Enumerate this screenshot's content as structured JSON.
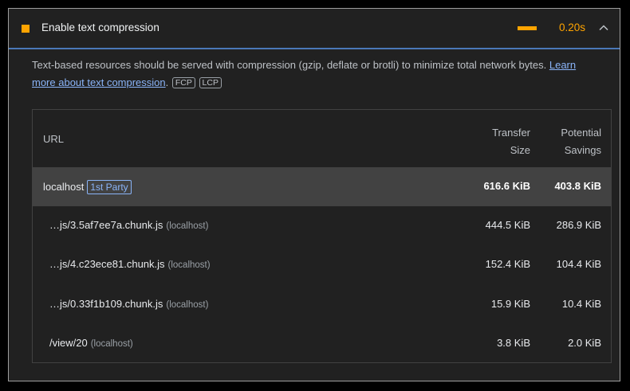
{
  "audit": {
    "title": "Enable text compression",
    "savings": "0.20s",
    "status_color": "#ffa400",
    "icon": "chevron-up-icon"
  },
  "description": {
    "text": "Text-based resources should be served with compression (gzip, deflate or brotli) to minimize total network bytes. ",
    "link_text": "Learn more about text compression",
    "after_link": ".",
    "badges": [
      "FCP",
      "LCP"
    ]
  },
  "table": {
    "headers": {
      "url": "URL",
      "transfer_size_line1": "Transfer",
      "transfer_size_line2": "Size",
      "savings_line1": "Potential",
      "savings_line2": "Savings"
    },
    "group": {
      "name": "localhost",
      "badge": "1st Party",
      "transfer_size": "616.6 KiB",
      "savings": "403.8 KiB"
    },
    "rows": [
      {
        "url": "…js/3.5af7ee7a.chunk.js",
        "origin": "(localhost)",
        "transfer_size": "444.5 KiB",
        "savings": "286.9 KiB"
      },
      {
        "url": "…js/4.c23ece81.chunk.js",
        "origin": "(localhost)",
        "transfer_size": "152.4 KiB",
        "savings": "104.4 KiB"
      },
      {
        "url": "…js/0.33f1b109.chunk.js",
        "origin": "(localhost)",
        "transfer_size": "15.9 KiB",
        "savings": "10.4 KiB"
      },
      {
        "url": "/view/20",
        "origin": "(localhost)",
        "transfer_size": "3.8 KiB",
        "savings": "2.0 KiB"
      }
    ]
  }
}
